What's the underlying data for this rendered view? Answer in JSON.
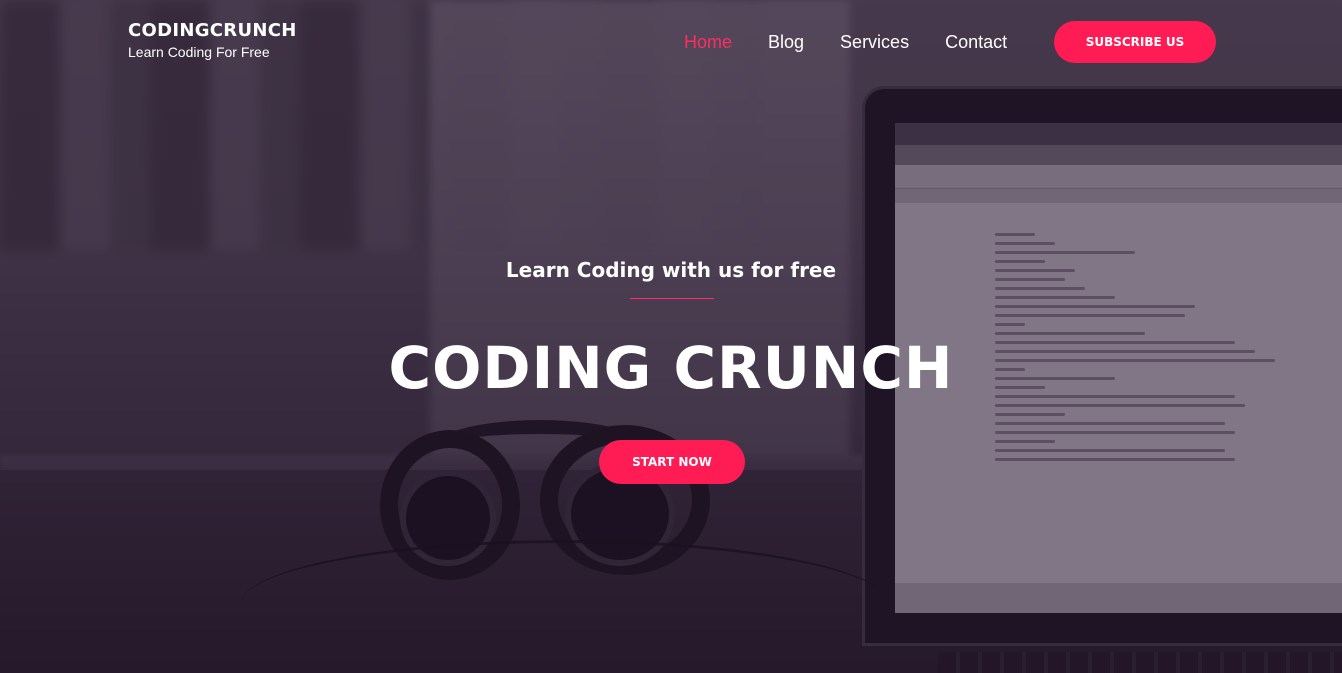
{
  "brand": {
    "name": "CODINGCRUNCH",
    "tagline": "Learn Coding For Free"
  },
  "nav": {
    "items": [
      {
        "label": "Home",
        "active": true
      },
      {
        "label": "Blog",
        "active": false
      },
      {
        "label": "Services",
        "active": false
      },
      {
        "label": "Contact",
        "active": false
      }
    ],
    "subscribe_label": "SUBSCRIBE US"
  },
  "hero": {
    "subtitle": "Learn Coding with us for free",
    "title": "CODING CRUNCH",
    "cta_label": "START NOW"
  },
  "colors": {
    "accent": "#ff1c55",
    "active_link": "#ff2d60",
    "overlay": "#28162f",
    "text": "#ffffff"
  }
}
